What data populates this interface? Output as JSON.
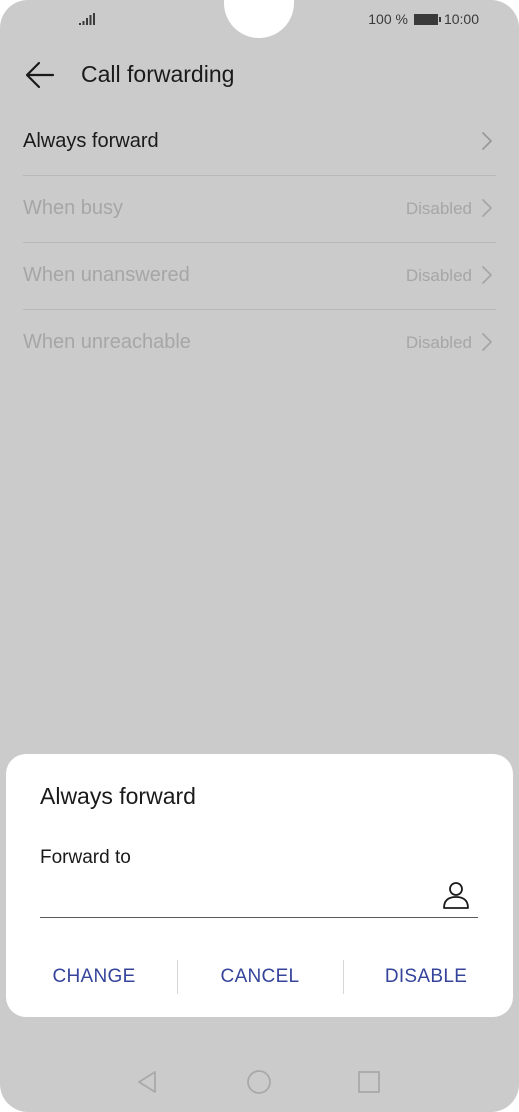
{
  "status_bar": {
    "signal_icon": "signal-bars-icon",
    "battery_text": "100 %",
    "battery_icon": "battery-icon",
    "time": "10:00"
  },
  "header": {
    "back_icon": "arrow-left-icon",
    "title": "Call forwarding"
  },
  "settings": {
    "items": [
      {
        "label": "Always forward",
        "value": "",
        "enabled": true
      },
      {
        "label": "When busy",
        "value": "Disabled",
        "enabled": false
      },
      {
        "label": "When unanswered",
        "value": "Disabled",
        "enabled": false
      },
      {
        "label": "When unreachable",
        "value": "Disabled",
        "enabled": false
      }
    ]
  },
  "dialog": {
    "title": "Always forward",
    "field_label": "Forward to",
    "field_value": "",
    "contact_icon": "person-icon",
    "actions": {
      "change": "CHANGE",
      "cancel": "CANCEL",
      "disable": "DISABLE"
    }
  },
  "nav_bar": {
    "back_icon": "triangle-back-icon",
    "home_icon": "circle-home-icon",
    "recents_icon": "square-recents-icon"
  },
  "colors": {
    "background_dim": "#cbcbcb",
    "accent": "#35449b",
    "disabled_text": "#a6a6a6"
  }
}
